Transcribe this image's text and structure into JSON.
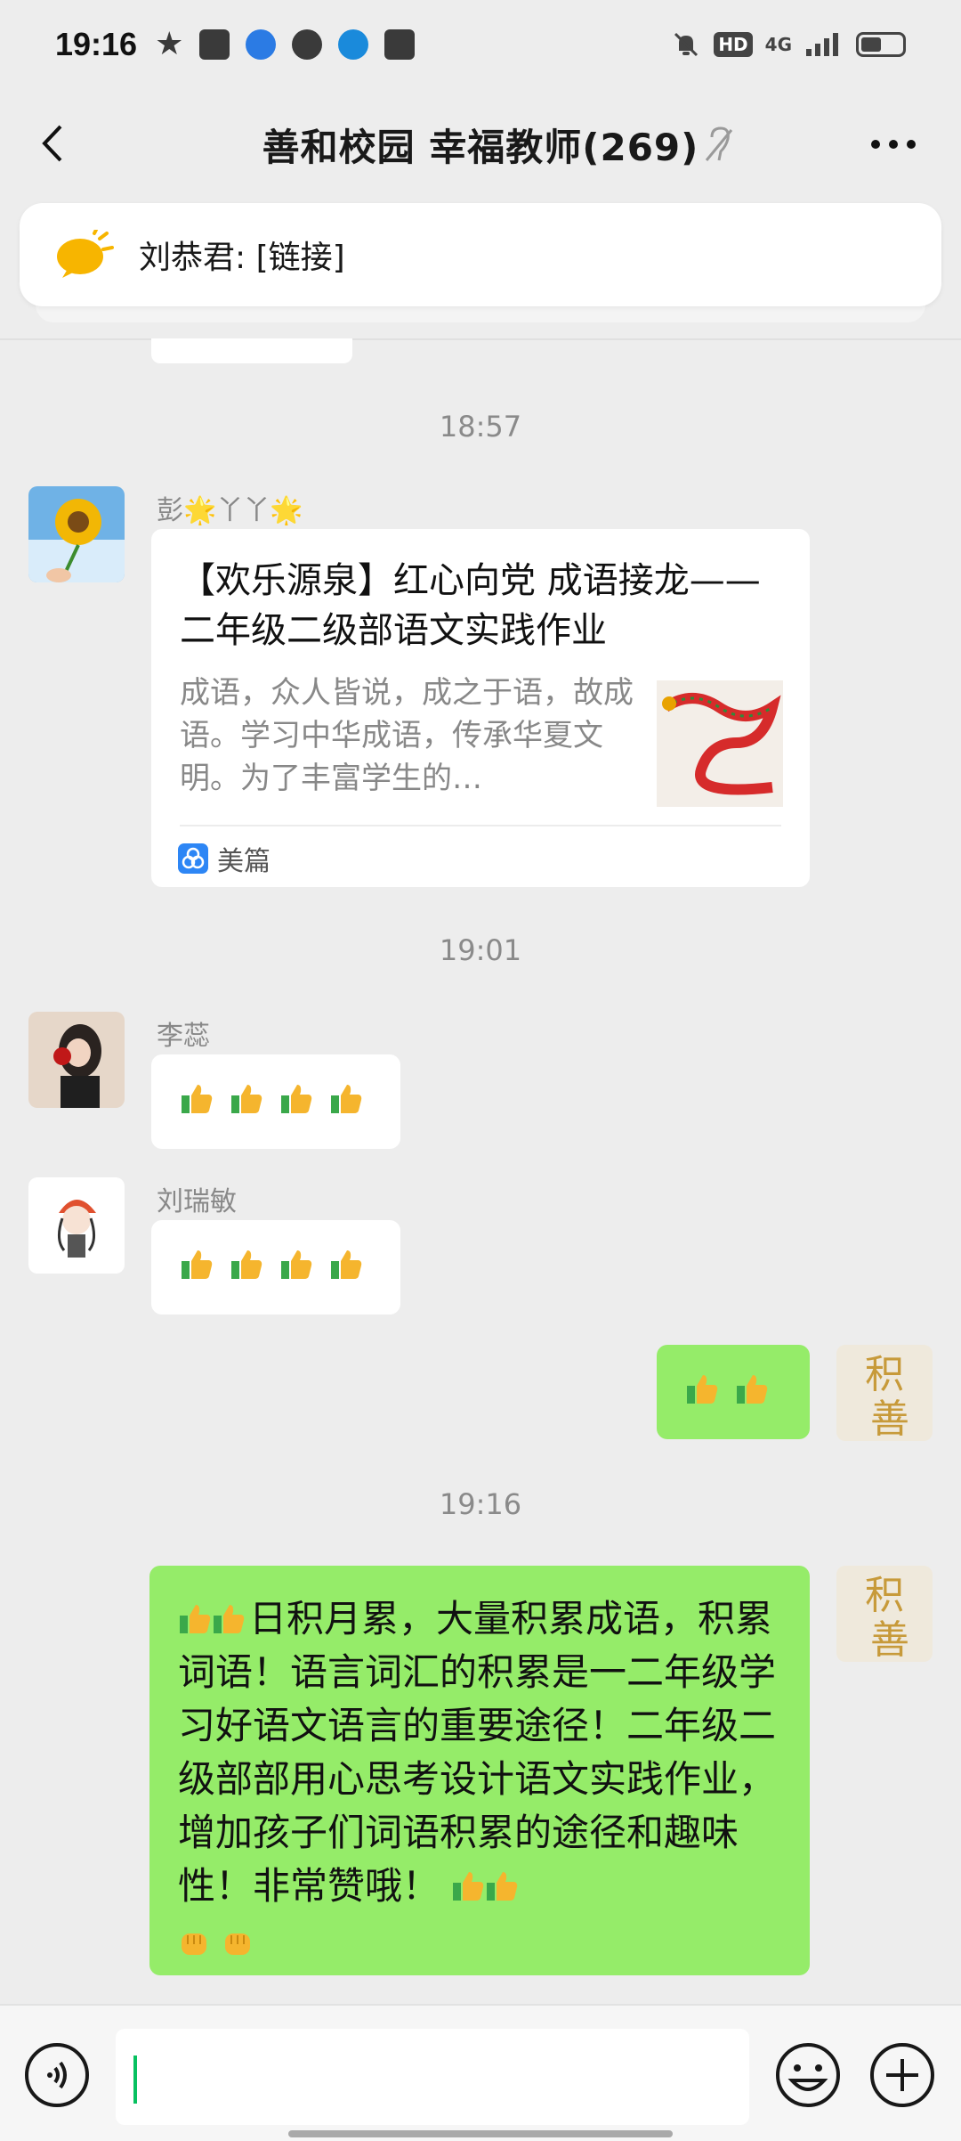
{
  "status_bar": {
    "time": "19:16",
    "icons": [
      "star-icon",
      "toutiao-icon",
      "chat-bubble-icon",
      "message-icon",
      "edge-icon",
      "app-icon"
    ],
    "right_icons": [
      "mute-bell-icon",
      "hd-icon",
      "4g-signal-icon",
      "battery-icon"
    ],
    "network": "4G",
    "hd": "HD"
  },
  "header": {
    "title": "善和校园  幸福教师(269)"
  },
  "pinned": {
    "text": "刘恭君: [链接]"
  },
  "messages": [
    {
      "type": "timestamp",
      "text": "18:57"
    },
    {
      "type": "card",
      "sender": "彭🌟丫丫🌟",
      "title": "【欢乐源泉】红心向党 成语接龙——二年级二级部语文实践作业",
      "description": "成语，众人皆说，成之于语，故成语。学习中华成语，传承华夏文明。为了丰富学生的…",
      "source": "美篇"
    },
    {
      "type": "timestamp",
      "text": "19:01"
    },
    {
      "type": "text",
      "sender": "李蕊",
      "content_icons": [
        "thumbs-up",
        "thumbs-up",
        "thumbs-up",
        "thumbs-up"
      ]
    },
    {
      "type": "text",
      "sender": "刘瑞敏",
      "content_icons": [
        "thumbs-up",
        "thumbs-up",
        "thumbs-up",
        "thumbs-up"
      ]
    },
    {
      "type": "text",
      "sender": "me",
      "content_icons": [
        "thumbs-up",
        "thumbs-up"
      ]
    },
    {
      "type": "timestamp",
      "text": "19:16"
    },
    {
      "type": "text",
      "sender": "me",
      "text": "日积月累，大量积累成语，积累词语！语言词汇的积累是一二年级学习好语文语言的重要途径！二年级二级部部用心思考设计语文实践作业，增加孩子们词语积累的途径和趣味性！非常赞哦！"
    }
  ],
  "colors": {
    "bg": "#ededed",
    "bubble_in": "#ffffff",
    "bubble_out": "#95ec69",
    "cursor": "#07c160"
  }
}
